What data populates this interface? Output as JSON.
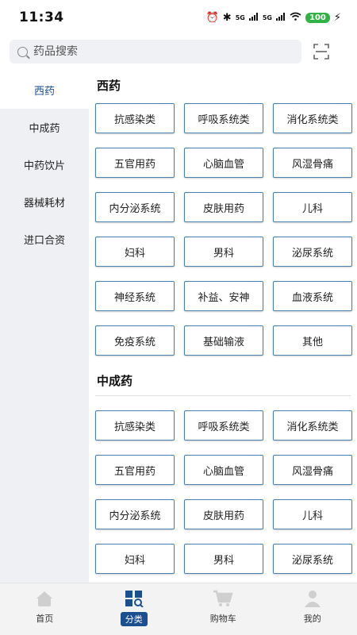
{
  "status": {
    "time": "11:34",
    "signal1": "5G",
    "signal2": "5G",
    "battery": "100"
  },
  "search": {
    "placeholder": "药品搜索"
  },
  "sidebar": {
    "items": [
      {
        "label": "西药",
        "active": true
      },
      {
        "label": "中成药",
        "active": false
      },
      {
        "label": "中药饮片",
        "active": false
      },
      {
        "label": "器械耗材",
        "active": false
      },
      {
        "label": "进口合资",
        "active": false
      }
    ]
  },
  "sections": [
    {
      "title": "西药",
      "items": [
        "抗感染类",
        "呼吸系统类",
        "消化系统类",
        "五官用药",
        "心脑血管",
        "风湿骨痛",
        "内分泌系统",
        "皮肤用药",
        "儿科",
        "妇科",
        "男科",
        "泌尿系统",
        "神经系统",
        "补益、安神",
        "血液系统",
        "免疫系统",
        "基础输液",
        "其他"
      ]
    },
    {
      "title": "中成药",
      "items": [
        "抗感染类",
        "呼吸系统类",
        "消化系统类",
        "五官用药",
        "心脑血管",
        "风湿骨痛",
        "内分泌系统",
        "皮肤用药",
        "儿科",
        "妇科",
        "男科",
        "泌尿系统"
      ]
    }
  ],
  "bottom_nav": {
    "items": [
      {
        "label": "首页",
        "icon": "home-icon",
        "active": false
      },
      {
        "label": "分类",
        "icon": "category-icon",
        "active": true
      },
      {
        "label": "购物车",
        "icon": "cart-icon",
        "active": false
      },
      {
        "label": "我的",
        "icon": "profile-icon",
        "active": false
      }
    ]
  },
  "colors": {
    "accent": "#1b4f8f",
    "button_border": "#4a7fb3",
    "sidebar_bg": "#eef0f3",
    "battery": "#2fb344"
  }
}
